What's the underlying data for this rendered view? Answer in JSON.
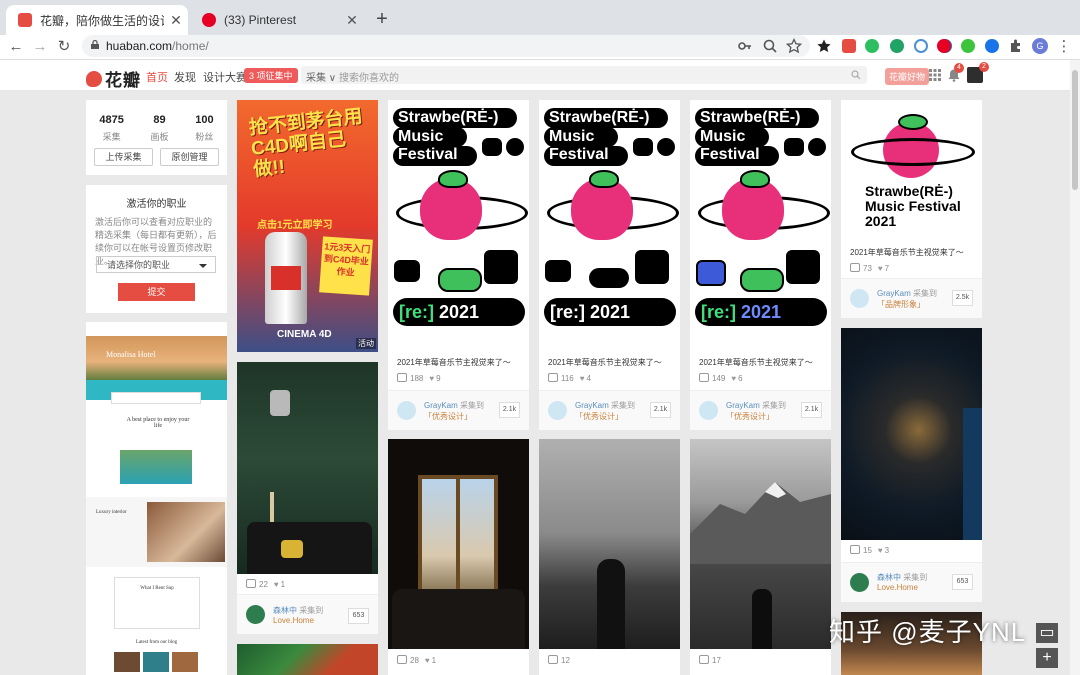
{
  "browser": {
    "tabs": [
      {
        "title": "花瓣，陪你做生活的设计师(家居",
        "active": true,
        "favicon_color": "#e54d42"
      },
      {
        "title": "(33) Pinterest",
        "active": false,
        "favicon_color": "#e60023"
      }
    ],
    "url_host": "huaban.com",
    "url_path": "/home/"
  },
  "site": {
    "logo_text": "花瓣",
    "nav": [
      {
        "label": "首页",
        "current": true
      },
      {
        "label": "发现",
        "current": false
      },
      {
        "label": "设计大赛",
        "current": false
      }
    ],
    "contest_pill": "3 项征集中",
    "search_category": "采集 ∨",
    "search_placeholder": "搜索你喜欢的",
    "vip_button": "花瓣好物",
    "notifications_count": "4",
    "messages_count": "2",
    "accent": "#e54d42"
  },
  "sidebar": {
    "stats": [
      {
        "value": "4875",
        "label": "采集"
      },
      {
        "value": "89",
        "label": "画板"
      },
      {
        "value": "100",
        "label": "粉丝"
      }
    ],
    "upload_button": "上传采集",
    "manage_button": "原创管理",
    "job_title": "激活你的职业",
    "job_desc": "激活后你可以查看对应职业的精选采集（每日都有更新），后续你可以在帐号设置页修改职业。",
    "job_select": "请选择你的职业",
    "submit_button": "提交"
  },
  "poster": {
    "line1": "Strawbe(RĖ-)",
    "line2": "Music",
    "line3": "Festival",
    "year_re": "[re:]",
    "year": "2021",
    "big_line1": "Strawbe(RĖ-)",
    "big_line2": "Music Festival",
    "big_year": "2021"
  },
  "c4d_ad": {
    "headline": "抢不到茅台用C4D啊自己做!!",
    "cta": "点击1元立即学习",
    "badge": "1元3天入门到C4D毕业作业",
    "brand": "CINEMA 4D",
    "tag": "活动"
  },
  "pins": [
    {
      "id": "fest1",
      "desc": "2021年草莓音乐节主视觉来了～",
      "repins": "188",
      "likes": "9",
      "user": "GrayKam",
      "action": "采集到",
      "board": "「优秀设计」",
      "count": "2.1k"
    },
    {
      "id": "fest2",
      "desc": "2021年草莓音乐节主视觉来了～",
      "repins": "116",
      "likes": "4",
      "user": "GrayKam",
      "action": "采集到",
      "board": "「优秀设计」",
      "count": "2.1k"
    },
    {
      "id": "fest3",
      "desc": "2021年草莓音乐节主视觉来了～",
      "repins": "149",
      "likes": "6",
      "user": "GrayKam",
      "action": "采集到",
      "board": "「优秀设计」",
      "count": "2.1k"
    },
    {
      "id": "fest4",
      "desc": "2021年草莓音乐节主视觉来了～",
      "repins": "73",
      "likes": "7",
      "user": "GrayKam",
      "action": "采集到",
      "board": "「品牌形象」",
      "count": "2.5k"
    },
    {
      "id": "green",
      "repins": "22",
      "likes": "1",
      "user": "森林中",
      "action": "采集到",
      "board": "Love.Home",
      "count": "653"
    },
    {
      "id": "chandelier",
      "repins": "15",
      "likes": "3",
      "user": "森林中",
      "action": "采集到",
      "board": "Love.Home",
      "count": "653"
    },
    {
      "id": "window",
      "repins": "28",
      "likes": "1"
    },
    {
      "id": "girl",
      "repins": "12"
    },
    {
      "id": "mountain",
      "repins": "17"
    }
  ],
  "hotel": {
    "name": "Monalisa Hotel",
    "tagline": "A best place to enjoy your life",
    "section2": "Luxury interior",
    "section3": "What I Rent Sup",
    "section4": "Latest from our blog"
  },
  "watermark": "知乎 @麦子YNL"
}
